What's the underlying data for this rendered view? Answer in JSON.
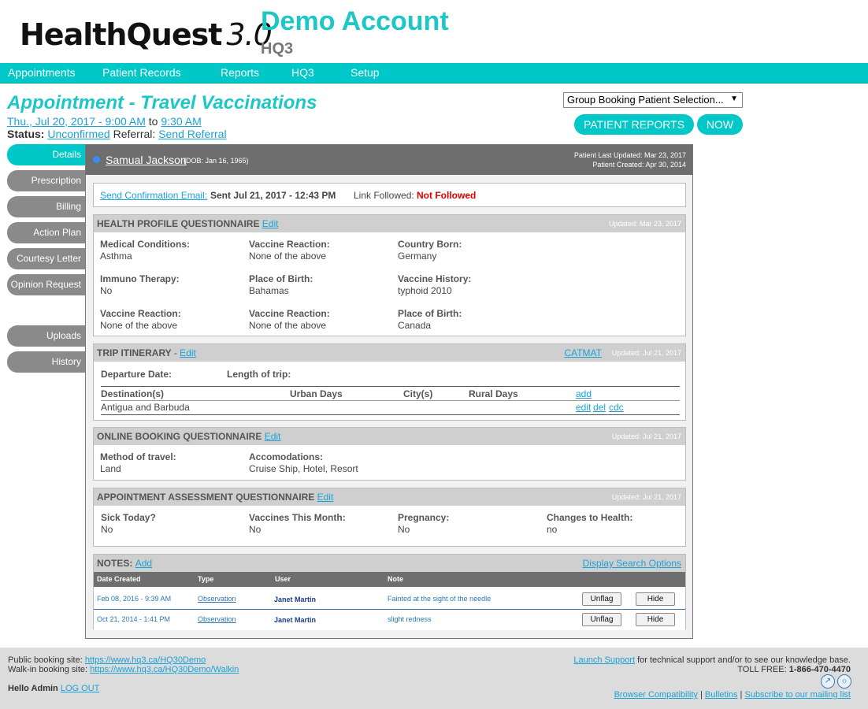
{
  "header": {
    "logo_bold": "HealthQuest",
    "logo_version": "3.0",
    "account_name": "Demo Account",
    "account_code": "HQ3"
  },
  "nav": [
    "Appointments",
    "Patient Records",
    "Reports",
    "HQ3",
    "Setup"
  ],
  "appointment": {
    "title": "Appointment - Travel Vaccinations",
    "start": "Thu., Jul 20, 2017 - 9:00 AM",
    "to": "to",
    "end": "9:30 AM",
    "status_label": "Status:",
    "status_value": "Unconfirmed",
    "referral_label": "Referral:",
    "referral_value": "Send Referral"
  },
  "controls": {
    "group_select": "Group Booking Patient Selection...",
    "patient_reports": "PATIENT REPORTS",
    "now": "NOW"
  },
  "side_tabs": [
    "Details",
    "Prescription",
    "Billing",
    "Action Plan",
    "Courtesy Letter",
    "Opinion Request",
    "Uploads",
    "History"
  ],
  "patient": {
    "name": "Samual Jackson",
    "dob": "(DOB: Jan 16, 1965)",
    "last_updated": "Patient Last Updated: Mar 23, 2017",
    "created": "Patient Created: Apr 30, 2014"
  },
  "confirmation": {
    "link": "Send Confirmation Email:",
    "sent": "Sent Jul 21, 2017 - 12:43 PM",
    "link_followed_label": "Link Followed:",
    "link_followed_value": "Not Followed"
  },
  "health_profile": {
    "title": "HEALTH PROFILE QUESTIONNAIRE",
    "edit": "Edit",
    "updated": "Updated: Mar 23, 2017",
    "fields": [
      {
        "label": "Medical Conditions:",
        "value": "Asthma"
      },
      {
        "label": "Vaccine Reaction:",
        "value": "None of the above"
      },
      {
        "label": "Country Born:",
        "value": "Germany"
      },
      {
        "label": "Immuno Therapy:",
        "value": "No"
      },
      {
        "label": "Place of Birth:",
        "value": "Bahamas"
      },
      {
        "label": "Vaccine History:",
        "value": "typhoid 2010"
      },
      {
        "label": "Vaccine Reaction:",
        "value": "None of the above"
      },
      {
        "label": "Vaccine Reaction:",
        "value": "None of the above"
      },
      {
        "label": "Place of Birth:",
        "value": "Canada"
      }
    ]
  },
  "trip": {
    "title": "TRIP ITINERARY",
    "sep": "-",
    "edit": "Edit",
    "catmat": "CATMAT",
    "updated": "Updated: Jul 21, 2017",
    "departure_label": "Departure Date:",
    "length_label": "Length of trip:",
    "columns": [
      "Destination(s)",
      "Urban Days",
      "City(s)",
      "Rural Days"
    ],
    "add": "add",
    "row": {
      "destination": "Antigua and Barbuda",
      "edit": "edit",
      "del": "del",
      "cdc": "cdc"
    }
  },
  "online_booking": {
    "title": "ONLINE BOOKING QUESTIONNAIRE",
    "edit": "Edit",
    "updated": "Updated: Jul 21, 2017",
    "fields": [
      {
        "label": "Method of travel:",
        "value": "Land"
      },
      {
        "label": "Accomodations:",
        "value": "Cruise Ship, Hotel, Resort"
      }
    ]
  },
  "assessment": {
    "title": "APPOINTMENT ASSESSMENT QUESTIONNAIRE",
    "edit": "Edit",
    "updated": "Updated: Jul 21, 2017",
    "fields": [
      {
        "label": "Sick Today?",
        "value": "No"
      },
      {
        "label": "Vaccines This Month:",
        "value": "No"
      },
      {
        "label": "Pregnancy:",
        "value": "No"
      },
      {
        "label": "Changes to Health:",
        "value": "no"
      }
    ]
  },
  "notes": {
    "title": "NOTES:",
    "add": "Add",
    "search_options": "Display Search Options",
    "columns": [
      "Date Created",
      "Type",
      "User",
      "Note"
    ],
    "rows": [
      {
        "date": "Feb 08, 2016 - 9:39 AM",
        "type": "Observation",
        "user": "Janet Martin",
        "note": "Fainted at the sight of the needle",
        "flag": "Unflag",
        "hide": "Hide"
      },
      {
        "date": "Oct 21, 2014 - 1:41 PM",
        "type": "Observation",
        "user": "Janet Martin",
        "note": "slight redness",
        "flag": "Unflag",
        "hide": "Hide"
      }
    ]
  },
  "footer": {
    "public_label": "Public booking site:",
    "public_url": "https://www.hq3.ca/HQ30Demo",
    "walkin_label": "Walk-in booking site:",
    "walkin_url": "https://www.hq3.ca/HQ30Demo/Walkin",
    "hello": "Hello Admin",
    "logout": "LOG OUT",
    "launch_support": "Launch Support",
    "support_text": "for technical support and/or to see our knowledge base.",
    "toll_free_label": "TOLL FREE:",
    "toll_free_number": "1-866-470-4470",
    "browser_compat": "Browser Compatibility",
    "bulletins": "Bulletins",
    "subscribe": "Subscribe to our mailing list"
  }
}
